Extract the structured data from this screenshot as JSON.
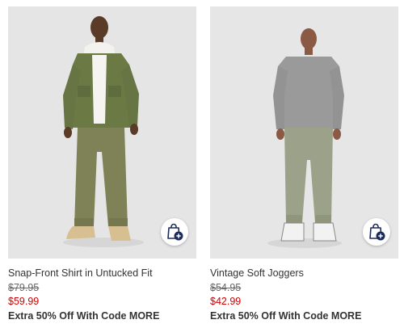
{
  "products": [
    {
      "name": "Snap-Front Shirt in Untucked Fit",
      "original_price": "$79.95",
      "sale_price": "$59.99",
      "promo": "Extra 50% Off With Code MORE",
      "image_icon": "model-photo-olive-shirt",
      "bag_icon": "add-to-bag-icon"
    },
    {
      "name": "Vintage Soft Joggers",
      "original_price": "$54.95",
      "sale_price": "$42.99",
      "promo": "Extra 50% Off With Code MORE",
      "image_icon": "model-photo-joggers",
      "bag_icon": "add-to-bag-icon"
    }
  ],
  "colors": {
    "sale": "#d00000",
    "navy_badge": "#1d2b5c",
    "image_bg": "#e6e6e6"
  }
}
